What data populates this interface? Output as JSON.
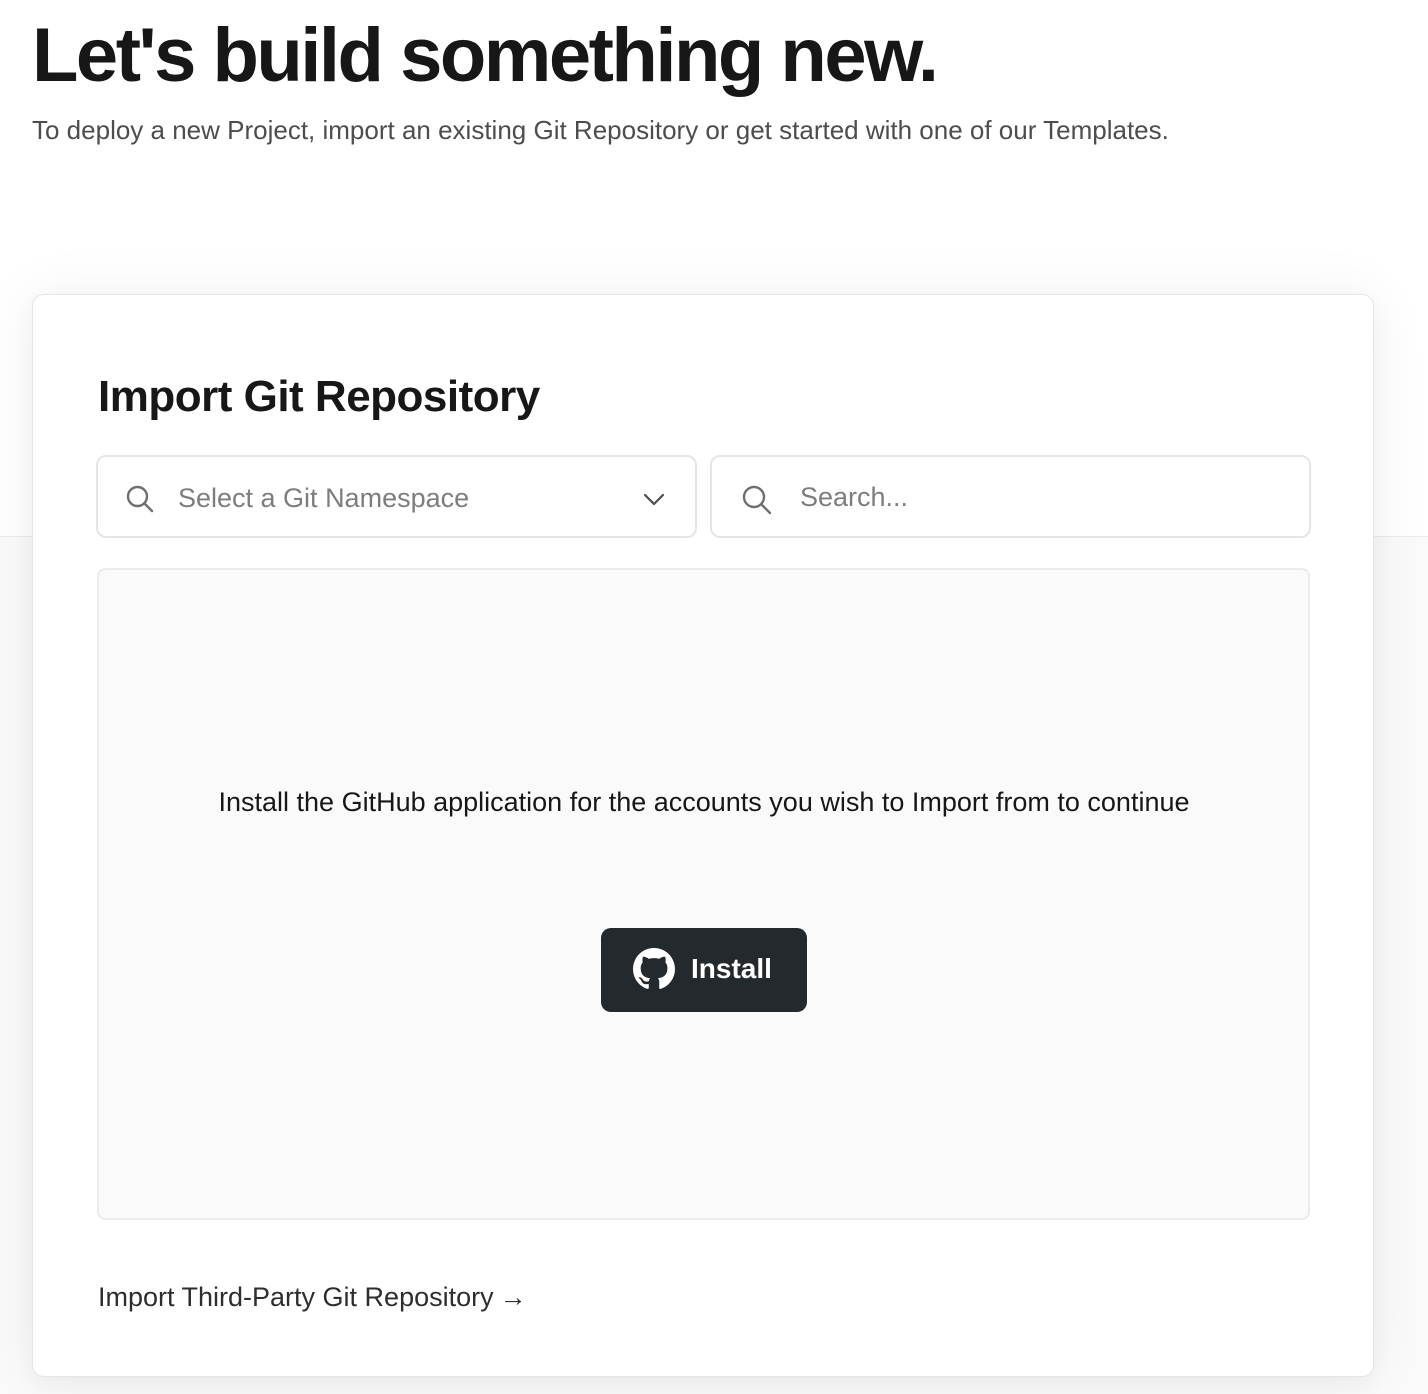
{
  "hero": {
    "title": "Let's build something new.",
    "subtitle": "To deploy a new Project, import an existing Git Repository or get started with one of our Templates."
  },
  "import_card": {
    "title": "Import Git Repository",
    "namespace_select": {
      "placeholder": "Select a Git Namespace",
      "icon": "search-icon",
      "dropdown_icon": "chevron-down-icon"
    },
    "search": {
      "placeholder": "Search...",
      "value": "",
      "icon": "search-icon"
    },
    "empty_state": {
      "message": "Install the GitHub application for the accounts you wish to Import from to continue",
      "install_button_label": "Install",
      "install_button_icon": "github-icon"
    },
    "third_party_link": {
      "label": "Import Third-Party Git Repository",
      "arrow": "→"
    }
  },
  "colors": {
    "text_primary": "#171717",
    "text_secondary": "#4d4d4d",
    "placeholder": "#7d7d7d",
    "button_bg": "#24292e",
    "panel_bg": "#fafafa",
    "border": "#e5e5e5"
  }
}
